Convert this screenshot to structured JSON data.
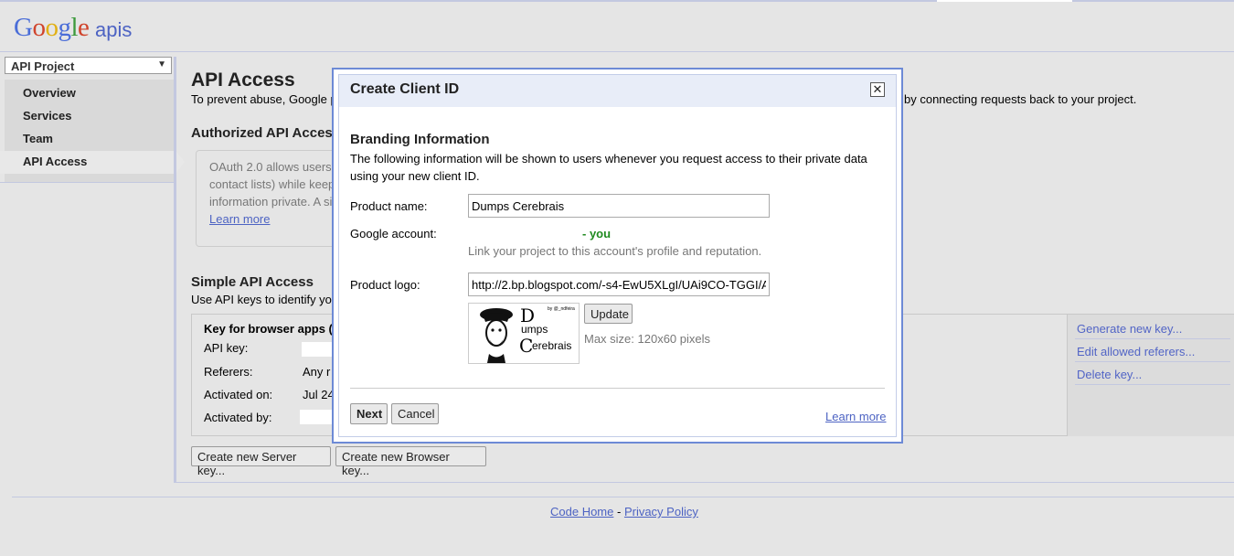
{
  "header": {
    "logo_text": "Google",
    "apis_text": "apis"
  },
  "sidebar": {
    "project_select": "API Project",
    "items": [
      {
        "label": "Overview"
      },
      {
        "label": "Services"
      },
      {
        "label": "Team"
      },
      {
        "label": "API Access"
      }
    ]
  },
  "main": {
    "title": "API Access",
    "intro_start": "To prevent abuse, Google p",
    "intro_end": "by connecting requests back to your project.",
    "authorized_heading": "Authorized API Access",
    "oauth_lines": [
      "OAuth 2.0 allows users",
      "contact lists) while keep",
      "information private. A si"
    ],
    "oauth_learn_more": "Learn more",
    "simple_heading": "Simple API Access",
    "simple_intro": "Use API keys to identify yo",
    "key_panel": {
      "title": "Key for browser apps (",
      "rows": [
        {
          "label": "API key:",
          "value": ""
        },
        {
          "label": "Referers:",
          "value": "Any r"
        },
        {
          "label": "Activated on:",
          "value": "Jul 24"
        },
        {
          "label": "Activated by:",
          "value": ""
        }
      ]
    },
    "actions": [
      "Generate new key...",
      "Edit allowed referers...",
      "Delete key..."
    ],
    "buttons": {
      "server_key": "Create new Server key...",
      "browser_key": "Create new Browser key..."
    }
  },
  "footer": {
    "code_home": "Code Home",
    "separator": " - ",
    "privacy": "Privacy Policy"
  },
  "dialog": {
    "title": "Create Client ID",
    "close_icon": "close-icon",
    "branding_heading": "Branding Information",
    "branding_desc": "The following information will be shown to users whenever you request access to their private data using your new client ID.",
    "product_name_label": "Product name:",
    "product_name_value": "Dumps Cerebrais",
    "google_account_label": "Google account:",
    "google_account_value": "- you",
    "account_note": "Link your project to this account's profile and reputation.",
    "product_logo_label": "Product logo:",
    "product_logo_value": "http://2.bp.blogspot.com/-s4-EwU5XLgI/UAi9CO-TGGI/A",
    "logo_preview": {
      "line1": "D",
      "line2": "umps",
      "line3": "C",
      "line4": "erebrais",
      "tag": "by @_ndfeira"
    },
    "update_button": "Update",
    "size_note": "Max size: 120x60 pixels",
    "next_button": "Next",
    "cancel_button": "Cancel",
    "learn_more": "Learn more"
  }
}
